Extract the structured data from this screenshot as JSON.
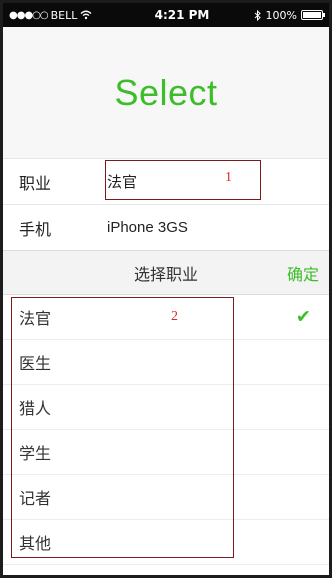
{
  "status_bar": {
    "carrier": "BELL",
    "signal": "●●●○○",
    "time": "4:21 PM",
    "battery": "100%"
  },
  "header": {
    "title": "Select"
  },
  "form": {
    "rows": [
      {
        "label": "职业",
        "value": "法官"
      },
      {
        "label": "手机",
        "value": "iPhone 3GS"
      }
    ]
  },
  "picker": {
    "title": "选择职业",
    "confirm_label": "确定",
    "options": [
      "法官",
      "医生",
      "猎人",
      "学生",
      "记者",
      "其他"
    ],
    "selected_index": 0
  },
  "annotations": {
    "box1_label": "1",
    "box2_label": "2",
    "box_color": "#7a1a1a",
    "number_color": "#d82b2b"
  },
  "colors": {
    "accent": "#3dbd2a"
  }
}
